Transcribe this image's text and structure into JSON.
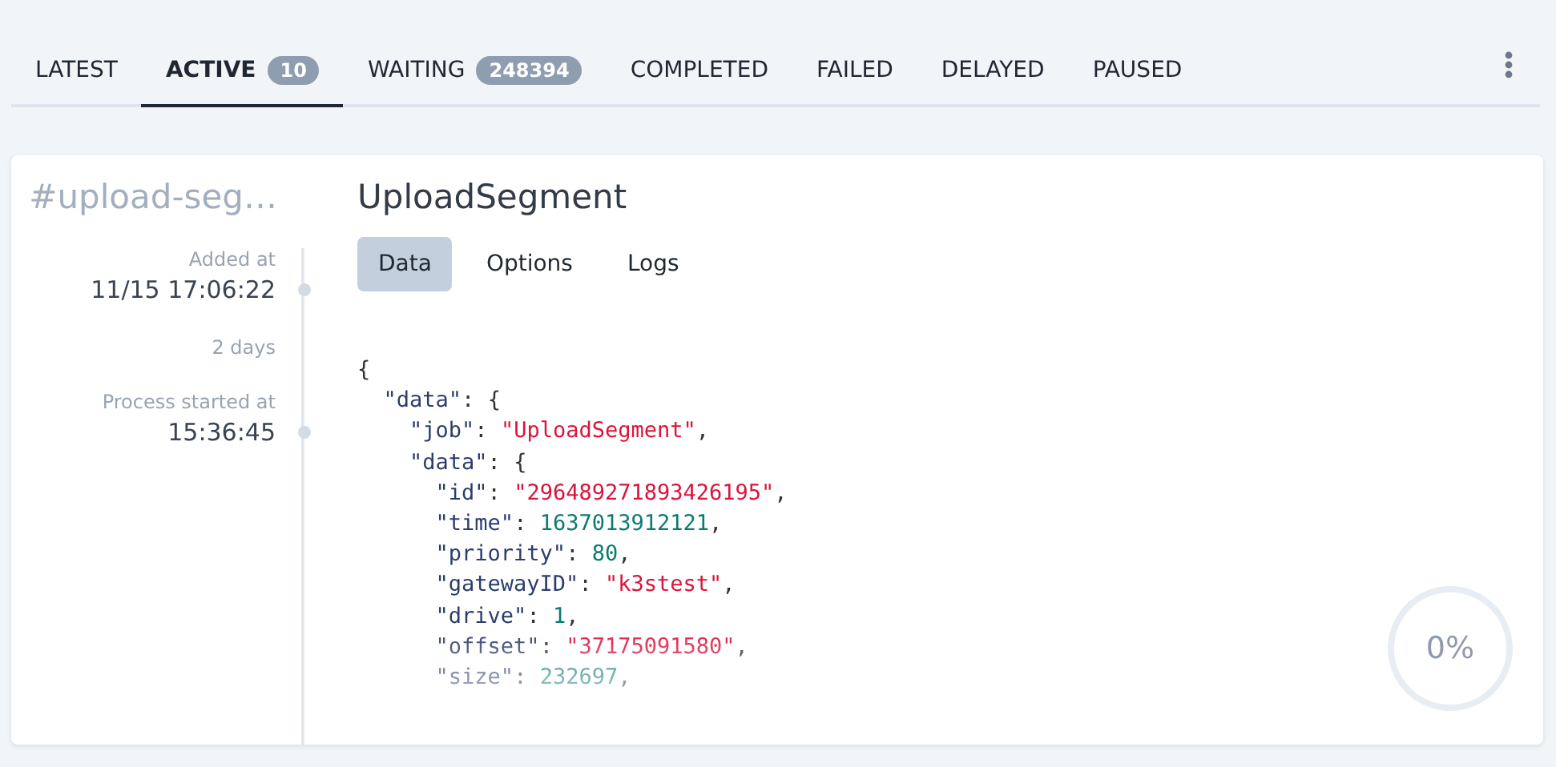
{
  "tabs": [
    {
      "label": "LATEST",
      "selected": false
    },
    {
      "label": "ACTIVE",
      "selected": true,
      "count": "10"
    },
    {
      "label": "WAITING",
      "selected": false,
      "count": "248394"
    },
    {
      "label": "COMPLETED",
      "selected": false
    },
    {
      "label": "FAILED",
      "selected": false
    },
    {
      "label": "DELAYED",
      "selected": false
    },
    {
      "label": "PAUSED",
      "selected": false
    }
  ],
  "job": {
    "id": "#upload-seg…",
    "name": "UploadSegment",
    "timeline": [
      {
        "kind": "event",
        "label": "Added at",
        "value": "11/15 17:06:22"
      },
      {
        "kind": "gap",
        "label": "2 days"
      },
      {
        "kind": "event",
        "label": "Process started at",
        "value": "15:36:45"
      }
    ],
    "detail_tabs": [
      {
        "label": "Data",
        "selected": true
      },
      {
        "label": "Options",
        "selected": false
      },
      {
        "label": "Logs",
        "selected": false
      }
    ],
    "code": {
      "open": "{",
      "children": [
        {
          "key": "\"data\"",
          "colon": ":",
          "value": "{",
          "kind": "object",
          "children": [
            {
              "key": "\"job\"",
              "colon": ":",
              "value": "\"UploadSegment\"",
              "kind": "string",
              "comma": ","
            },
            {
              "key": "\"data\"",
              "colon": ":",
              "value": "{",
              "kind": "object",
              "children": [
                {
                  "key": "\"id\"",
                  "colon": ":",
                  "value": "\"296489271893426195\"",
                  "kind": "string",
                  "comma": ","
                },
                {
                  "key": "\"time\"",
                  "colon": ":",
                  "value": "1637013912121",
                  "kind": "number",
                  "comma": ","
                },
                {
                  "key": "\"priority\"",
                  "colon": ":",
                  "value": "80",
                  "kind": "number",
                  "comma": ","
                },
                {
                  "key": "\"gatewayID\"",
                  "colon": ":",
                  "value": "\"k3stest\"",
                  "kind": "string",
                  "comma": ","
                },
                {
                  "key": "\"drive\"",
                  "colon": ":",
                  "value": "1",
                  "kind": "number",
                  "comma": ","
                },
                {
                  "key": "\"offset\"",
                  "colon": ":",
                  "value": "\"37175091580\"",
                  "kind": "string",
                  "comma": ","
                },
                {
                  "key": "\"size\"",
                  "colon": ":",
                  "value": "232697",
                  "kind": "number",
                  "comma": ","
                }
              ]
            }
          ]
        }
      ]
    },
    "progress": {
      "reading": "0%"
    }
  }
}
